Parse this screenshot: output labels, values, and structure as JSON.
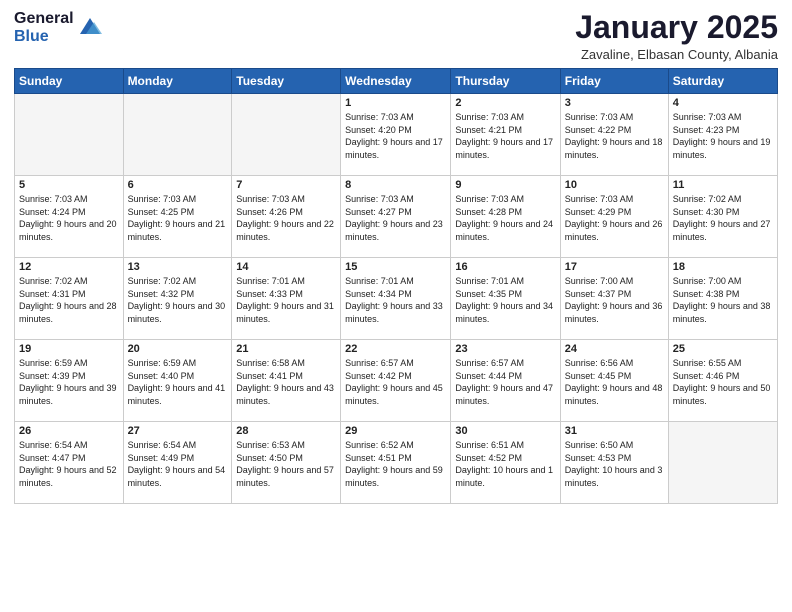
{
  "logo": {
    "general": "General",
    "blue": "Blue"
  },
  "header": {
    "month": "January 2025",
    "location": "Zavaline, Elbasan County, Albania"
  },
  "weekdays": [
    "Sunday",
    "Monday",
    "Tuesday",
    "Wednesday",
    "Thursday",
    "Friday",
    "Saturday"
  ],
  "weeks": [
    [
      {
        "day": "",
        "info": ""
      },
      {
        "day": "",
        "info": ""
      },
      {
        "day": "",
        "info": ""
      },
      {
        "day": "1",
        "info": "Sunrise: 7:03 AM\nSunset: 4:20 PM\nDaylight: 9 hours and 17 minutes."
      },
      {
        "day": "2",
        "info": "Sunrise: 7:03 AM\nSunset: 4:21 PM\nDaylight: 9 hours and 17 minutes."
      },
      {
        "day": "3",
        "info": "Sunrise: 7:03 AM\nSunset: 4:22 PM\nDaylight: 9 hours and 18 minutes."
      },
      {
        "day": "4",
        "info": "Sunrise: 7:03 AM\nSunset: 4:23 PM\nDaylight: 9 hours and 19 minutes."
      }
    ],
    [
      {
        "day": "5",
        "info": "Sunrise: 7:03 AM\nSunset: 4:24 PM\nDaylight: 9 hours and 20 minutes."
      },
      {
        "day": "6",
        "info": "Sunrise: 7:03 AM\nSunset: 4:25 PM\nDaylight: 9 hours and 21 minutes."
      },
      {
        "day": "7",
        "info": "Sunrise: 7:03 AM\nSunset: 4:26 PM\nDaylight: 9 hours and 22 minutes."
      },
      {
        "day": "8",
        "info": "Sunrise: 7:03 AM\nSunset: 4:27 PM\nDaylight: 9 hours and 23 minutes."
      },
      {
        "day": "9",
        "info": "Sunrise: 7:03 AM\nSunset: 4:28 PM\nDaylight: 9 hours and 24 minutes."
      },
      {
        "day": "10",
        "info": "Sunrise: 7:03 AM\nSunset: 4:29 PM\nDaylight: 9 hours and 26 minutes."
      },
      {
        "day": "11",
        "info": "Sunrise: 7:02 AM\nSunset: 4:30 PM\nDaylight: 9 hours and 27 minutes."
      }
    ],
    [
      {
        "day": "12",
        "info": "Sunrise: 7:02 AM\nSunset: 4:31 PM\nDaylight: 9 hours and 28 minutes."
      },
      {
        "day": "13",
        "info": "Sunrise: 7:02 AM\nSunset: 4:32 PM\nDaylight: 9 hours and 30 minutes."
      },
      {
        "day": "14",
        "info": "Sunrise: 7:01 AM\nSunset: 4:33 PM\nDaylight: 9 hours and 31 minutes."
      },
      {
        "day": "15",
        "info": "Sunrise: 7:01 AM\nSunset: 4:34 PM\nDaylight: 9 hours and 33 minutes."
      },
      {
        "day": "16",
        "info": "Sunrise: 7:01 AM\nSunset: 4:35 PM\nDaylight: 9 hours and 34 minutes."
      },
      {
        "day": "17",
        "info": "Sunrise: 7:00 AM\nSunset: 4:37 PM\nDaylight: 9 hours and 36 minutes."
      },
      {
        "day": "18",
        "info": "Sunrise: 7:00 AM\nSunset: 4:38 PM\nDaylight: 9 hours and 38 minutes."
      }
    ],
    [
      {
        "day": "19",
        "info": "Sunrise: 6:59 AM\nSunset: 4:39 PM\nDaylight: 9 hours and 39 minutes."
      },
      {
        "day": "20",
        "info": "Sunrise: 6:59 AM\nSunset: 4:40 PM\nDaylight: 9 hours and 41 minutes."
      },
      {
        "day": "21",
        "info": "Sunrise: 6:58 AM\nSunset: 4:41 PM\nDaylight: 9 hours and 43 minutes."
      },
      {
        "day": "22",
        "info": "Sunrise: 6:57 AM\nSunset: 4:42 PM\nDaylight: 9 hours and 45 minutes."
      },
      {
        "day": "23",
        "info": "Sunrise: 6:57 AM\nSunset: 4:44 PM\nDaylight: 9 hours and 47 minutes."
      },
      {
        "day": "24",
        "info": "Sunrise: 6:56 AM\nSunset: 4:45 PM\nDaylight: 9 hours and 48 minutes."
      },
      {
        "day": "25",
        "info": "Sunrise: 6:55 AM\nSunset: 4:46 PM\nDaylight: 9 hours and 50 minutes."
      }
    ],
    [
      {
        "day": "26",
        "info": "Sunrise: 6:54 AM\nSunset: 4:47 PM\nDaylight: 9 hours and 52 minutes."
      },
      {
        "day": "27",
        "info": "Sunrise: 6:54 AM\nSunset: 4:49 PM\nDaylight: 9 hours and 54 minutes."
      },
      {
        "day": "28",
        "info": "Sunrise: 6:53 AM\nSunset: 4:50 PM\nDaylight: 9 hours and 57 minutes."
      },
      {
        "day": "29",
        "info": "Sunrise: 6:52 AM\nSunset: 4:51 PM\nDaylight: 9 hours and 59 minutes."
      },
      {
        "day": "30",
        "info": "Sunrise: 6:51 AM\nSunset: 4:52 PM\nDaylight: 10 hours and 1 minute."
      },
      {
        "day": "31",
        "info": "Sunrise: 6:50 AM\nSunset: 4:53 PM\nDaylight: 10 hours and 3 minutes."
      },
      {
        "day": "",
        "info": ""
      }
    ]
  ]
}
